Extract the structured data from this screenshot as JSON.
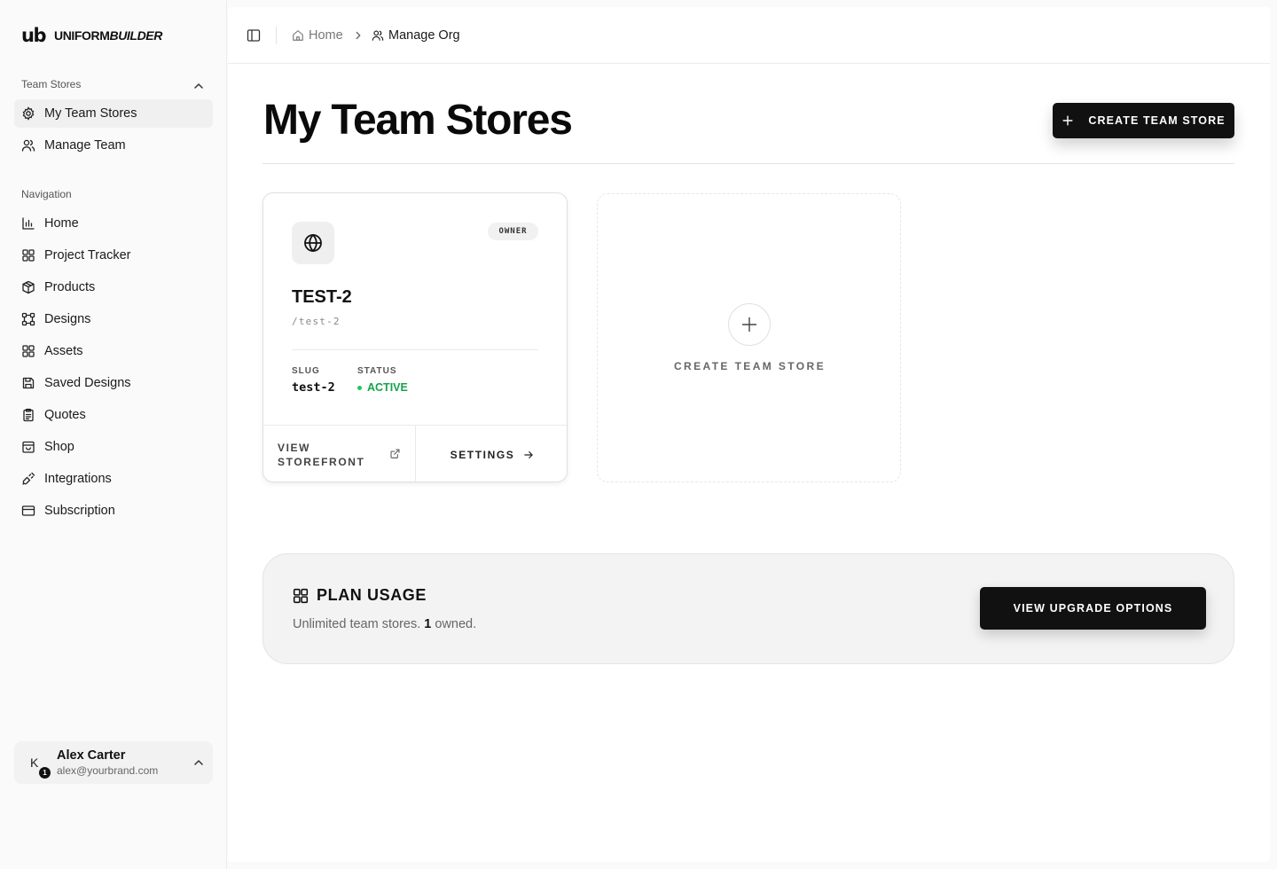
{
  "brand": {
    "mark": "ub",
    "name_prefix": "UNIFORM",
    "name_suffix": "BUILDER"
  },
  "sidebar": {
    "team_section": {
      "label": "Team Stores",
      "items": [
        {
          "label": "My Team Stores",
          "icon": "gear-icon",
          "active": true
        },
        {
          "label": "Manage Team",
          "icon": "users-icon",
          "active": false
        }
      ]
    },
    "nav_section": {
      "label": "Navigation",
      "items": [
        {
          "label": "Home",
          "icon": "bar-chart-icon"
        },
        {
          "label": "Project Tracker",
          "icon": "grid-icon"
        },
        {
          "label": "Products",
          "icon": "package-icon"
        },
        {
          "label": "Designs",
          "icon": "frame-icon"
        },
        {
          "label": "Assets",
          "icon": "grid-icon"
        },
        {
          "label": "Saved Designs",
          "icon": "save-icon"
        },
        {
          "label": "Quotes",
          "icon": "clipboard-icon"
        },
        {
          "label": "Shop",
          "icon": "store-icon"
        },
        {
          "label": "Integrations",
          "icon": "plug-icon"
        },
        {
          "label": "Subscription",
          "icon": "credit-card-icon"
        }
      ]
    },
    "user": {
      "initial": "K",
      "badge": "1",
      "name": "Alex Carter",
      "email": "alex@yourbrand.com"
    }
  },
  "breadcrumb": {
    "home": "Home",
    "current": "Manage Org"
  },
  "page": {
    "title": "My Team Stores",
    "create_button": "CREATE TEAM STORE"
  },
  "store_card": {
    "role_badge": "OWNER",
    "name": "TEST-2",
    "path": "/test-2",
    "slug_label": "SLUG",
    "slug_value": "test-2",
    "status_label": "STATUS",
    "status_value": "ACTIVE",
    "view_storefront": "VIEW STOREFRONT",
    "settings": "SETTINGS"
  },
  "create_card": {
    "label": "CREATE TEAM STORE"
  },
  "plan_usage": {
    "title": "PLAN USAGE",
    "text_before": "Unlimited team stores.",
    "owned_count": "1",
    "text_after": "owned.",
    "upgrade_button": "VIEW UPGRADE OPTIONS"
  },
  "colors": {
    "accent": "#111111",
    "status_active": "#16a34a",
    "sidebar_bg": "#fafafa"
  }
}
